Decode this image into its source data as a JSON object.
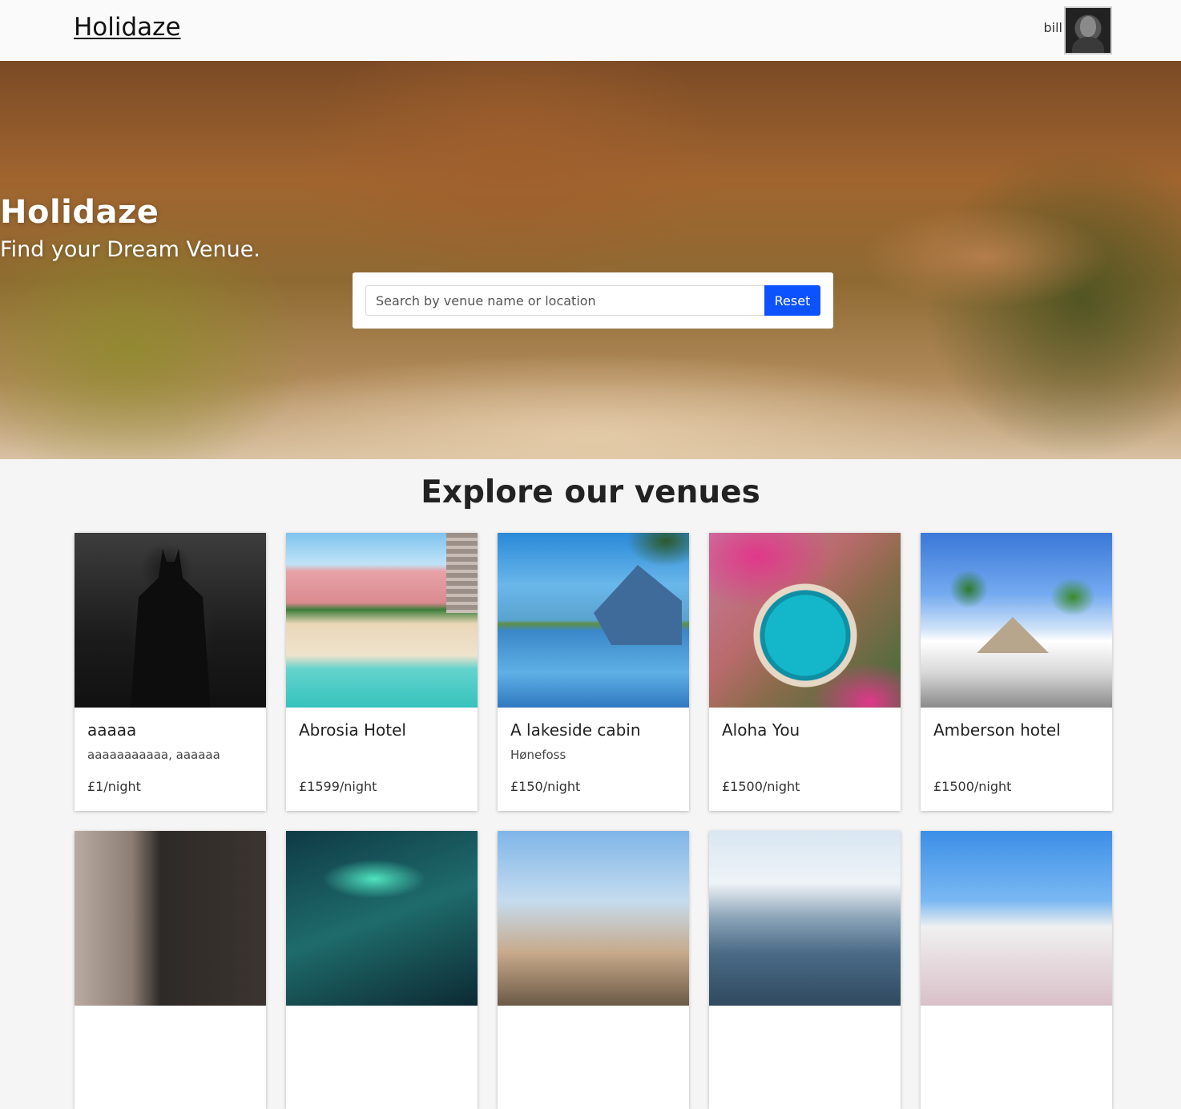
{
  "header": {
    "brand": "Holidaze",
    "user_name": "bill"
  },
  "hero": {
    "title": "Holidaze",
    "subtitle": "Find your Dream Venue.",
    "search_placeholder": "Search by venue name or location",
    "reset_label": "Reset"
  },
  "section": {
    "title": "Explore our venues"
  },
  "venues": [
    {
      "name": "aaaaa",
      "location": "aaaaaaaaaaa, aaaaaa",
      "price": "£1/night"
    },
    {
      "name": "Abrosia Hotel",
      "location": "",
      "price": "£1599/night"
    },
    {
      "name": "A lakeside cabin",
      "location": "Hønefoss",
      "price": "£150/night"
    },
    {
      "name": "Aloha You",
      "location": "",
      "price": "£1500/night"
    },
    {
      "name": "Amberson hotel",
      "location": "",
      "price": "£1500/night"
    }
  ],
  "colors": {
    "accent": "#0d52ff",
    "header_bg": "#fafafa",
    "page_bg": "#f5f5f5"
  }
}
